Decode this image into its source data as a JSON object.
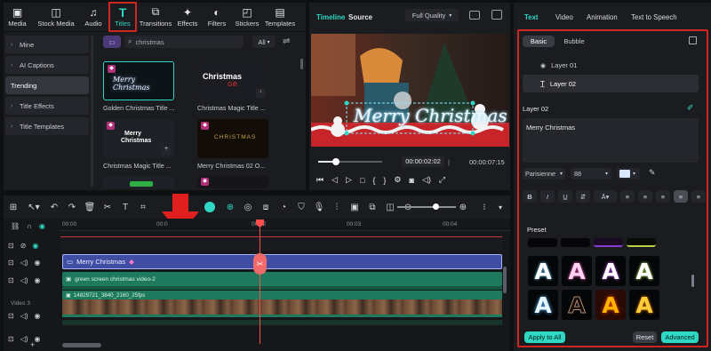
{
  "media_tabs": [
    {
      "label": "Media",
      "icon": "media-icon",
      "glyph": "▣"
    },
    {
      "label": "Stock Media",
      "icon": "stock-media-icon",
      "glyph": "◫"
    },
    {
      "label": "Audio",
      "icon": "music-note-icon",
      "glyph": "♫"
    },
    {
      "label": "Titles",
      "icon": "titles-t-icon",
      "glyph": "T"
    },
    {
      "label": "Transitions",
      "icon": "transitions-icon",
      "glyph": "⧉"
    },
    {
      "label": "Effects",
      "icon": "effects-icon",
      "glyph": "✦"
    },
    {
      "label": "Filters",
      "icon": "filters-icon",
      "glyph": "◐"
    },
    {
      "label": "Stickers",
      "icon": "stickers-icon",
      "glyph": "◰"
    },
    {
      "label": "Templates",
      "icon": "templates-icon",
      "glyph": "▤"
    }
  ],
  "sidebar": {
    "items": [
      "Mine",
      "AI Captions",
      "Trending",
      "Title Effects",
      "Title Templates"
    ]
  },
  "search": {
    "value": "christmas",
    "filter": "All"
  },
  "titles": [
    {
      "label": "Golden Christmas Title ...",
      "art": "Merry Christmas"
    },
    {
      "label": "Christmas Magic Title ...",
      "art": "Christmas",
      "art2": "Gift"
    },
    {
      "label": "Christmas Magic Title ...",
      "art": "Merry",
      "art2": "Christmas"
    },
    {
      "label": "Merry Christmas 02 O...",
      "art": "CHRISTMAS"
    }
  ],
  "preview": {
    "tab_timeline": "Timeline",
    "tab_source": "Source",
    "quality": "Full Quality",
    "overlay_text": "Merry Christmas",
    "time_current": "00:00:02:02",
    "time_total": "00:00:07:15"
  },
  "timeline": {
    "ruler": [
      "00:00",
      "00:0",
      "00:02",
      "00:03",
      "00:04"
    ],
    "clips": {
      "title": "Merry Christmas",
      "green": "green screen christmas video-2",
      "video": "14829721_3840_2160_25fps"
    },
    "track_label": "Video 3"
  },
  "right_panel": {
    "tabs": [
      "Text",
      "Video",
      "Animation",
      "Text to Speech"
    ],
    "subtabs": [
      "Basic",
      "Bubble"
    ],
    "layers": [
      "Layer 01",
      "Layer 02"
    ],
    "layer_title": "Layer 02",
    "text_value": "Merry Christmas",
    "font": "Parisienne",
    "size": "88",
    "preset_label": "Preset",
    "buttons": {
      "apply": "Apply to All",
      "reset": "Reset",
      "advanced": "Advanced"
    }
  },
  "colors": {
    "accent": "#2fd8c4",
    "highlight": "#d0241e",
    "title_clip": "#3f4ea3",
    "green_clip": "#1d7a5d",
    "playhead": "#ff4d4d"
  }
}
